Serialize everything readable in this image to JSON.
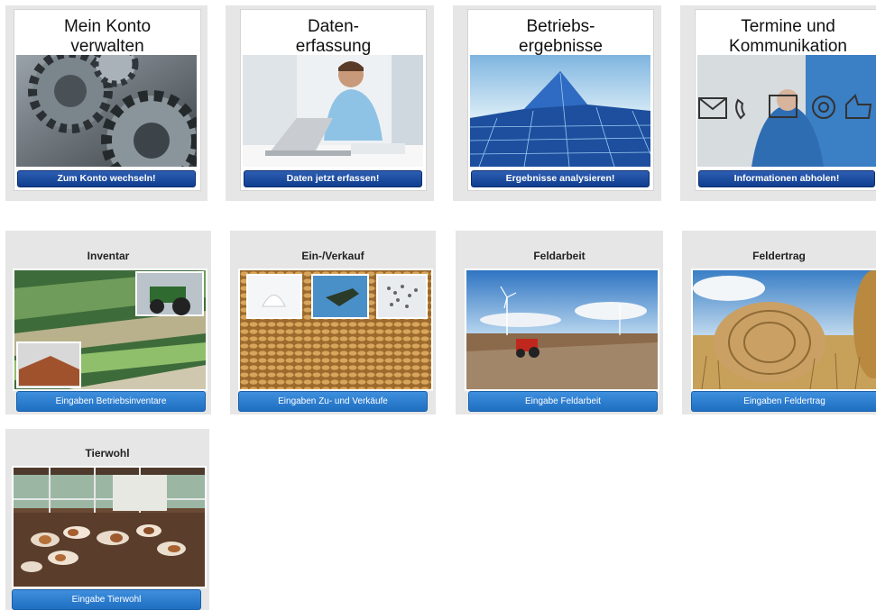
{
  "top_tiles": [
    {
      "title_line1": "Mein Konto",
      "title_line2": "verwalten",
      "button": "Zum Konto wechseln!",
      "icon": "gears-image"
    },
    {
      "title_line1": "Daten-",
      "title_line2": "erfassung",
      "button": "Daten jetzt erfassen!",
      "icon": "laptop-man-image"
    },
    {
      "title_line1": "Betriebs-",
      "title_line2": "ergebnisse",
      "button": "Ergebnisse analysieren!",
      "icon": "network-mountain-image"
    },
    {
      "title_line1": "Termine und",
      "title_line2": "Kommunikation",
      "button": "Informationen abholen!",
      "icon": "communication-icons-image"
    }
  ],
  "bottom_tiles": [
    {
      "title": "Inventar",
      "button": "Eingaben Betriebsinventare",
      "icon": "farmland-tractor-image"
    },
    {
      "title": "Ein-/Verkauf",
      "button": "Eingaben Zu- und Verkäufe",
      "icon": "grain-fuel-image"
    },
    {
      "title": "Feldarbeit",
      "button": "Eingabe Feldarbeit",
      "icon": "field-tractor-image"
    },
    {
      "title": "Feldertrag",
      "button": "Eingaben Feldertrag",
      "icon": "hay-bale-image"
    },
    {
      "title": "Tierwohl",
      "button": "Eingabe Tierwohl",
      "icon": "cows-barn-image"
    }
  ],
  "colors": {
    "tile_bg": "#e6e6e6",
    "dark_button": "#0f3d8f",
    "light_button": "#2a7bcf"
  }
}
